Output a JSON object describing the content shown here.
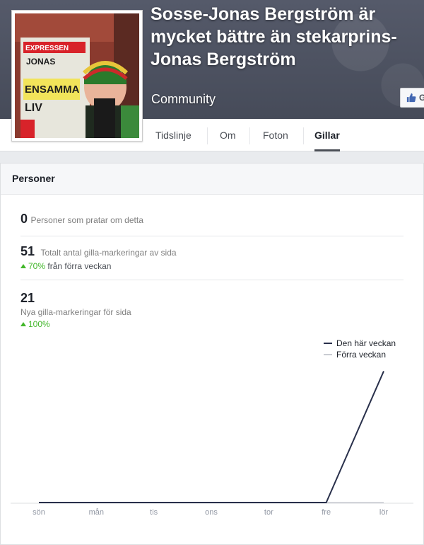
{
  "page": {
    "title": "Sosse-Jonas Bergström är mycket bättre än stekarprins-Jonas Bergström",
    "category": "Community",
    "like_button_label": "G"
  },
  "profile_picture": {
    "newspaper_masthead": "EXPRESSEN",
    "headline_lines": [
      "JONAS",
      "ENSAMMA",
      "LIV"
    ]
  },
  "tabs": [
    {
      "label": "Tidslinje",
      "active": false
    },
    {
      "label": "Om",
      "active": false
    },
    {
      "label": "Foton",
      "active": false
    },
    {
      "label": "Gillar",
      "active": true
    }
  ],
  "section": {
    "title": "Personer"
  },
  "stats": {
    "talking": {
      "value": "0",
      "label": "Personer som pratar om detta"
    },
    "total_likes": {
      "value": "51",
      "label": "Totalt antal gilla-markeringar av sida",
      "trend_value": "70%",
      "trend_text": "från förra veckan"
    },
    "new_likes": {
      "value": "21",
      "label": "Nya gilla-markeringar för sida",
      "trend_value": "100%"
    }
  },
  "colors": {
    "this_week": "#29304b",
    "last_week": "#c9ccd2",
    "trend_up": "#42b72a"
  },
  "chart_data": {
    "type": "line",
    "categories": [
      "sön",
      "mån",
      "tis",
      "ons",
      "tor",
      "fre",
      "lör"
    ],
    "series": [
      {
        "name": "Den här veckan",
        "values": [
          0,
          0,
          0,
          0,
          0,
          0,
          21
        ]
      },
      {
        "name": "Förra veckan",
        "values": [
          0,
          0,
          0,
          0,
          0,
          0,
          0
        ]
      }
    ],
    "ylim": [
      0,
      21.5
    ],
    "legend_position": "top-right",
    "grid": false
  }
}
